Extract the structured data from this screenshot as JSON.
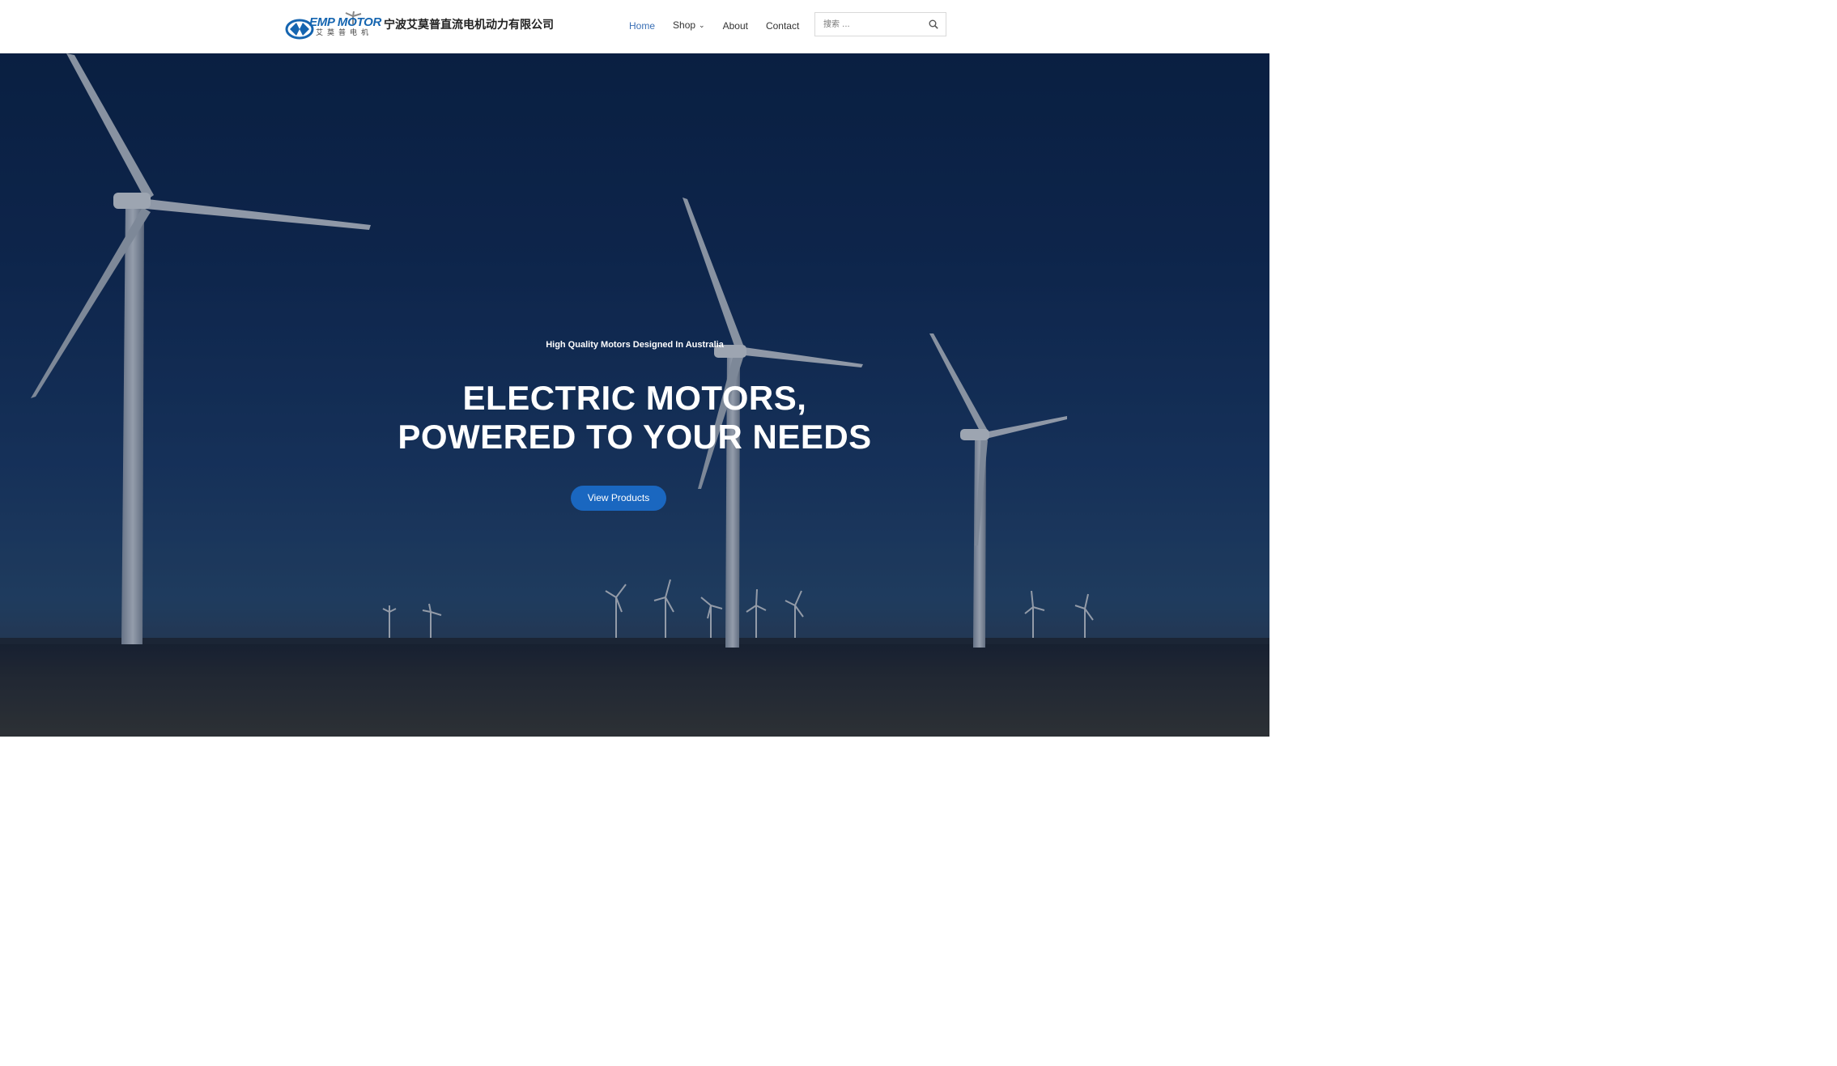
{
  "header": {
    "logo_text": "EMP MOTOR",
    "logo_subtext": "艾莫普电机",
    "company_name": "宁波艾莫普直流电机动力有限公司",
    "nav": [
      {
        "label": "Home",
        "active": true
      },
      {
        "label": "Shop",
        "has_dropdown": true
      },
      {
        "label": "About"
      },
      {
        "label": "Contact"
      }
    ],
    "search": {
      "placeholder": "搜索 ...",
      "icon": "search-icon"
    }
  },
  "hero": {
    "eyebrow": "High Quality Motors Designed In Australia",
    "title_line1": "ELECTRIC MOTORS,",
    "title_line2": "POWERED TO YOUR NEEDS",
    "button_label": "View Products",
    "background": "wind turbines at dusk"
  },
  "colors": {
    "accent": "#1a67c0",
    "nav_active": "#3a6fb5",
    "brand": "#1565b0",
    "hero_sky_top": "#0a2248",
    "hero_sky_bottom": "#27496f"
  }
}
